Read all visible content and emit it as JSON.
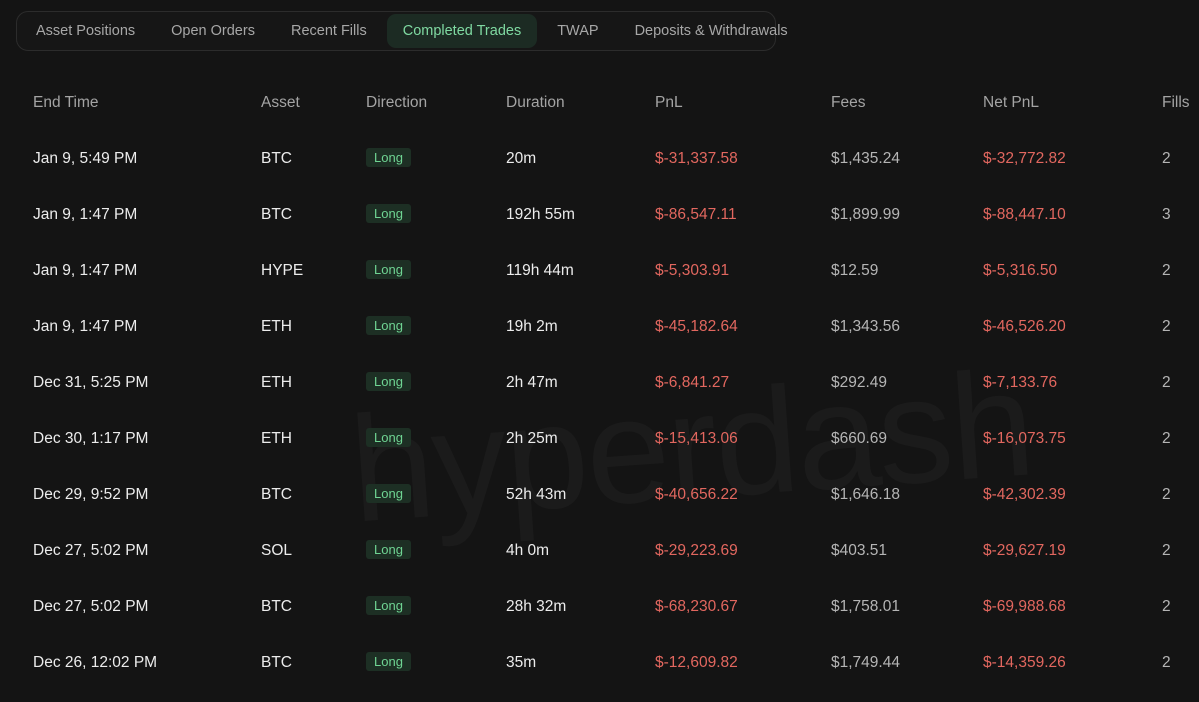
{
  "tabs": [
    {
      "label": "Asset Positions",
      "active": false
    },
    {
      "label": "Open Orders",
      "active": false
    },
    {
      "label": "Recent Fills",
      "active": false
    },
    {
      "label": "Completed Trades",
      "active": true
    },
    {
      "label": "TWAP",
      "active": false
    },
    {
      "label": "Deposits & Withdrawals",
      "active": false
    }
  ],
  "watermark": "hyperdash",
  "table": {
    "columns": {
      "end_time": "End Time",
      "asset": "Asset",
      "direction": "Direction",
      "duration": "Duration",
      "pnl": "PnL",
      "fees": "Fees",
      "net_pnl": "Net PnL",
      "fills": "Fills"
    },
    "rows": [
      {
        "end_time": "Jan 9, 5:49 PM",
        "asset": "BTC",
        "direction": "Long",
        "duration": "20m",
        "pnl": "$-31,337.58",
        "fees": "$1,435.24",
        "net_pnl": "$-32,772.82",
        "fills": "2"
      },
      {
        "end_time": "Jan 9, 1:47 PM",
        "asset": "BTC",
        "direction": "Long",
        "duration": "192h 55m",
        "pnl": "$-86,547.11",
        "fees": "$1,899.99",
        "net_pnl": "$-88,447.10",
        "fills": "3"
      },
      {
        "end_time": "Jan 9, 1:47 PM",
        "asset": "HYPE",
        "direction": "Long",
        "duration": "119h 44m",
        "pnl": "$-5,303.91",
        "fees": "$12.59",
        "net_pnl": "$-5,316.50",
        "fills": "2"
      },
      {
        "end_time": "Jan 9, 1:47 PM",
        "asset": "ETH",
        "direction": "Long",
        "duration": "19h 2m",
        "pnl": "$-45,182.64",
        "fees": "$1,343.56",
        "net_pnl": "$-46,526.20",
        "fills": "2"
      },
      {
        "end_time": "Dec 31, 5:25 PM",
        "asset": "ETH",
        "direction": "Long",
        "duration": "2h 47m",
        "pnl": "$-6,841.27",
        "fees": "$292.49",
        "net_pnl": "$-7,133.76",
        "fills": "2"
      },
      {
        "end_time": "Dec 30, 1:17 PM",
        "asset": "ETH",
        "direction": "Long",
        "duration": "2h 25m",
        "pnl": "$-15,413.06",
        "fees": "$660.69",
        "net_pnl": "$-16,073.75",
        "fills": "2"
      },
      {
        "end_time": "Dec 29, 9:52 PM",
        "asset": "BTC",
        "direction": "Long",
        "duration": "52h 43m",
        "pnl": "$-40,656.22",
        "fees": "$1,646.18",
        "net_pnl": "$-42,302.39",
        "fills": "2"
      },
      {
        "end_time": "Dec 27, 5:02 PM",
        "asset": "SOL",
        "direction": "Long",
        "duration": "4h 0m",
        "pnl": "$-29,223.69",
        "fees": "$403.51",
        "net_pnl": "$-29,627.19",
        "fills": "2"
      },
      {
        "end_time": "Dec 27, 5:02 PM",
        "asset": "BTC",
        "direction": "Long",
        "duration": "28h 32m",
        "pnl": "$-68,230.67",
        "fees": "$1,758.01",
        "net_pnl": "$-69,988.68",
        "fills": "2"
      },
      {
        "end_time": "Dec 26, 12:02 PM",
        "asset": "BTC",
        "direction": "Long",
        "duration": "35m",
        "pnl": "$-12,609.82",
        "fees": "$1,749.44",
        "net_pnl": "$-14,359.26",
        "fills": "2"
      }
    ]
  },
  "colors": {
    "background": "#141414",
    "tab_active_bg": "#1c2b23",
    "tab_active_text": "#7fd9a1",
    "negative": "#e2675f",
    "long_badge_text": "#6fd493",
    "long_badge_bg": "#1d2f24"
  }
}
